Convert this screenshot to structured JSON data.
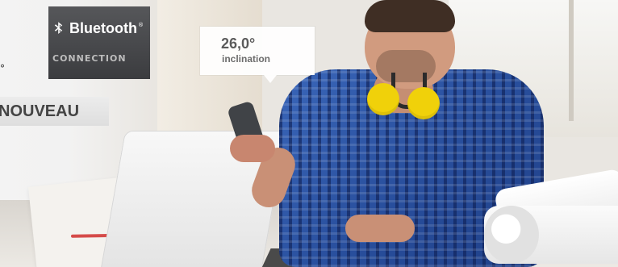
{
  "badge": {
    "brand": "Bluetooth",
    "brand_mark": "®",
    "subtitle": "CONNECTION"
  },
  "readout": {
    "angle": "26,0°",
    "label": "inclination"
  },
  "tag": {
    "label": "NOUVEAU"
  },
  "colors": {
    "badge_bg": "#4a4b4e",
    "badge_text": "#ffffff",
    "badge_subtext": "#bdbdbd",
    "readout_text": "#5b5b5b",
    "tag_bg": "#e4e4e4",
    "tag_text": "#444444",
    "earmuff_yellow": "#f0d10a",
    "shirt_blue": "#2f58a8"
  },
  "icons": {
    "bluetooth": "bluetooth-icon"
  },
  "artifacts": {
    "edge_mark": "°"
  }
}
